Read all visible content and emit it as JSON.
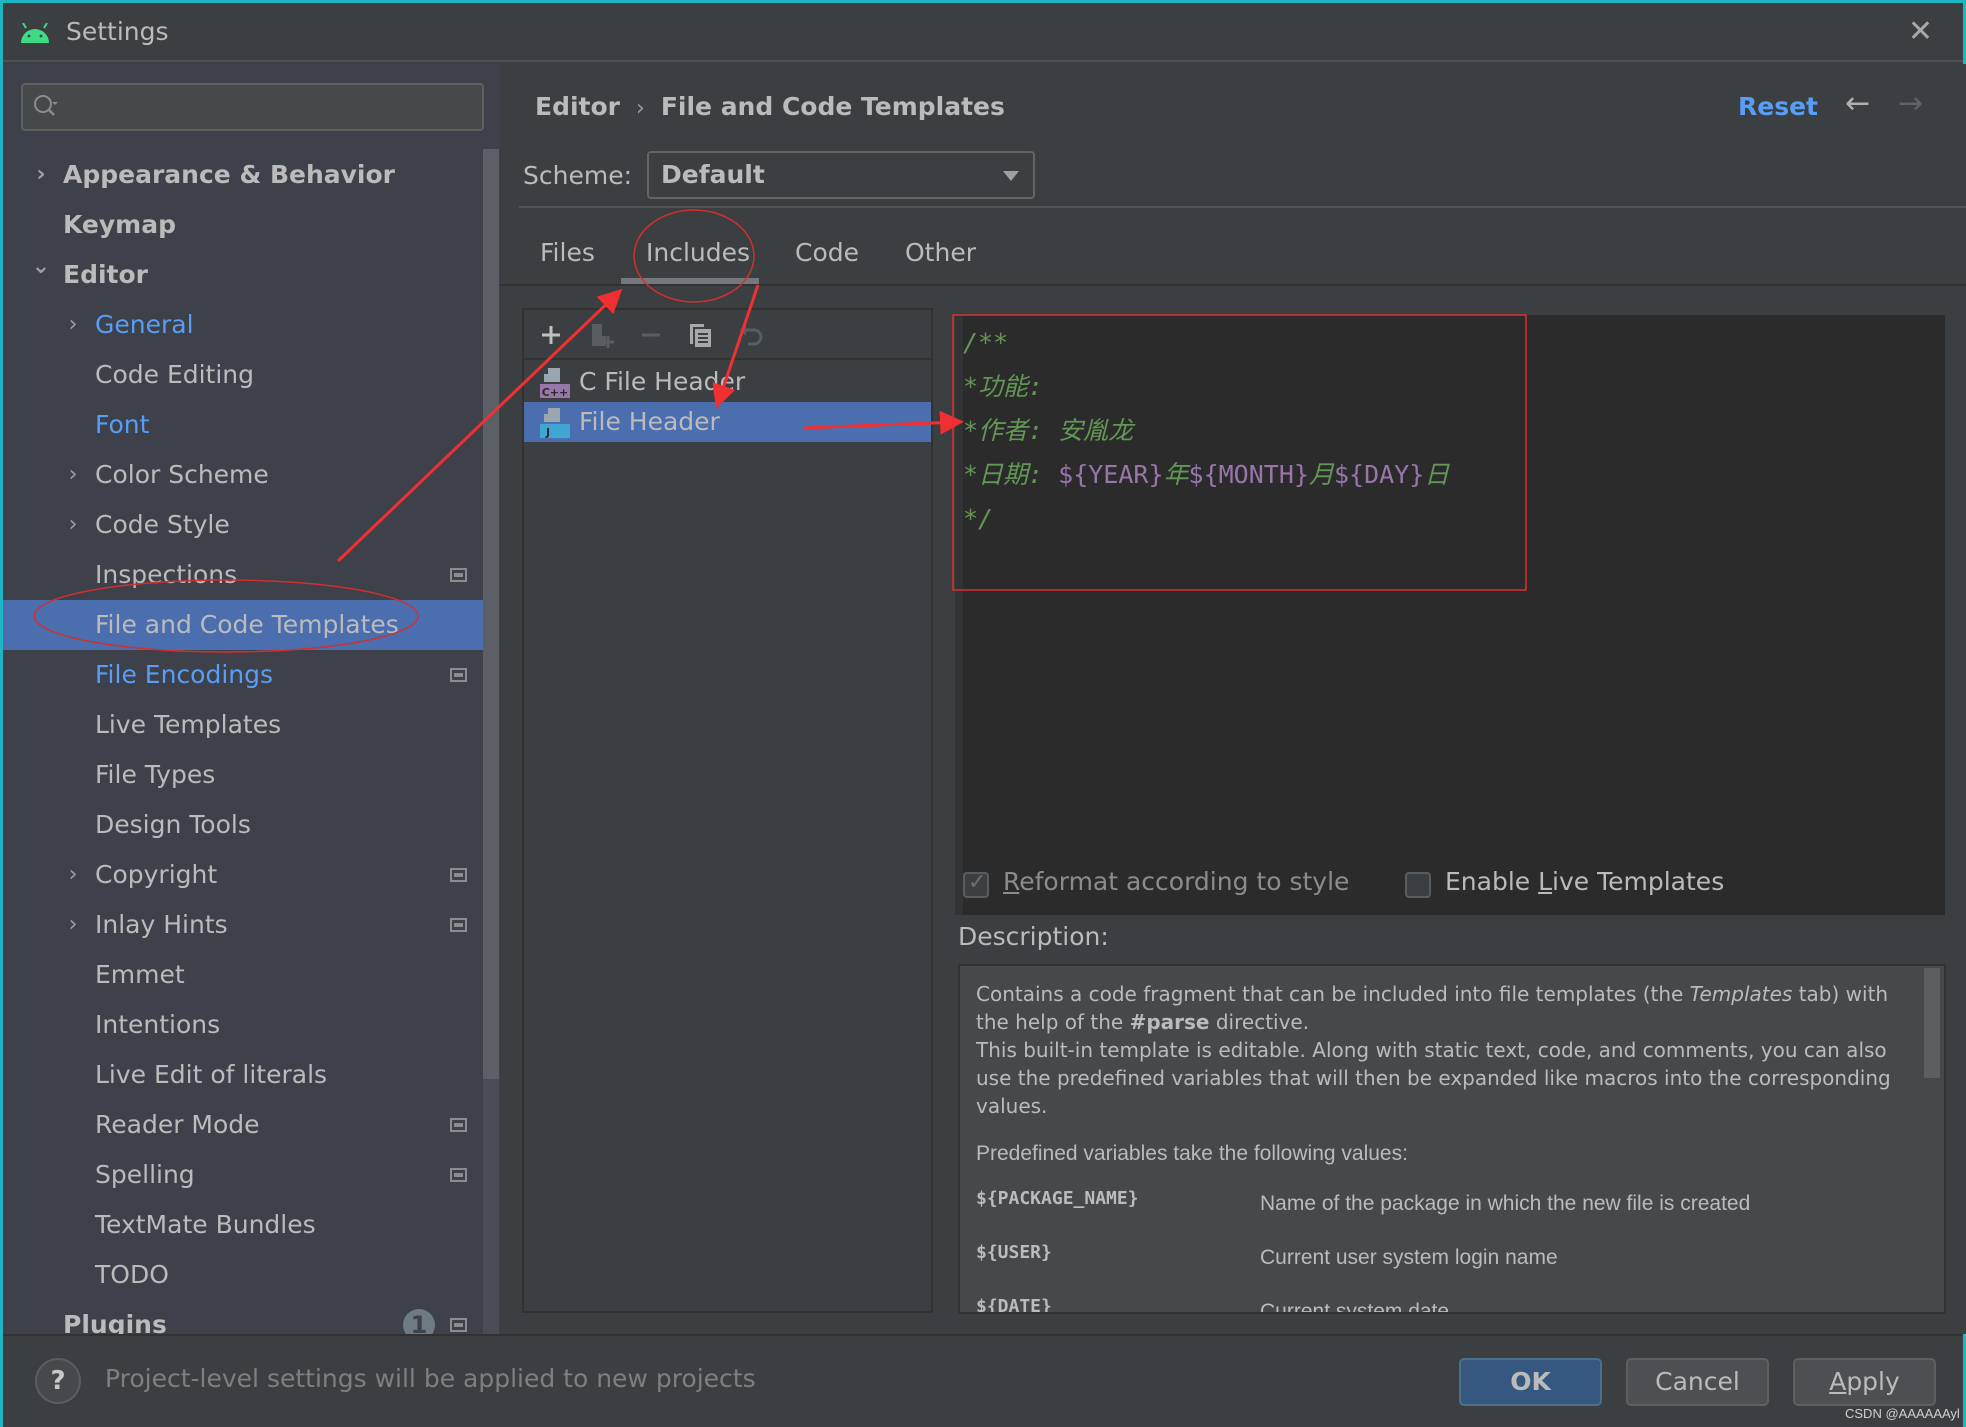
{
  "window": {
    "title": "Settings",
    "app_icon": "android-icon",
    "close_icon": "close-icon"
  },
  "sidebar": {
    "search": {
      "placeholder": "",
      "value": ""
    },
    "items": [
      {
        "label": "Appearance & Behavior",
        "level": 0,
        "bold": true,
        "expander": "collapsed"
      },
      {
        "label": "Keymap",
        "level": 0,
        "bold": true,
        "expander": "none"
      },
      {
        "label": "Editor",
        "level": 0,
        "bold": true,
        "expander": "expanded"
      },
      {
        "label": "General",
        "level": 1,
        "modified": true,
        "expander": "collapsed"
      },
      {
        "label": "Code Editing",
        "level": 1,
        "expander": "none"
      },
      {
        "label": "Font",
        "level": 1,
        "modified": true,
        "expander": "none"
      },
      {
        "label": "Color Scheme",
        "level": 1,
        "expander": "collapsed"
      },
      {
        "label": "Code Style",
        "level": 1,
        "expander": "collapsed"
      },
      {
        "label": "Inspections",
        "level": 1,
        "expander": "none",
        "project_level": true
      },
      {
        "label": "File and Code Templates",
        "level": 1,
        "expander": "none",
        "selected": true
      },
      {
        "label": "File Encodings",
        "level": 1,
        "modified": true,
        "expander": "none",
        "project_level": true
      },
      {
        "label": "Live Templates",
        "level": 1,
        "expander": "none"
      },
      {
        "label": "File Types",
        "level": 1,
        "expander": "none"
      },
      {
        "label": "Design Tools",
        "level": 1,
        "expander": "none"
      },
      {
        "label": "Copyright",
        "level": 1,
        "expander": "collapsed",
        "project_level": true
      },
      {
        "label": "Inlay Hints",
        "level": 1,
        "expander": "collapsed",
        "project_level": true
      },
      {
        "label": "Emmet",
        "level": 1,
        "expander": "none"
      },
      {
        "label": "Intentions",
        "level": 1,
        "expander": "none"
      },
      {
        "label": "Live Edit of literals",
        "level": 1,
        "expander": "none"
      },
      {
        "label": "Reader Mode",
        "level": 1,
        "expander": "none",
        "project_level": true
      },
      {
        "label": "Spelling",
        "level": 1,
        "expander": "none",
        "project_level": true
      },
      {
        "label": "TextMate Bundles",
        "level": 1,
        "expander": "none"
      },
      {
        "label": "TODO",
        "level": 1,
        "expander": "none"
      },
      {
        "label": "Plugins",
        "level": 0,
        "bold": true,
        "expander": "none",
        "badge": "1",
        "project_level": true
      }
    ]
  },
  "header": {
    "breadcrumb": [
      "Editor",
      "File and Code Templates"
    ],
    "breadcrumb_sep": "›",
    "reset_label": "Reset",
    "back_icon": "←",
    "forward_icon": "→"
  },
  "scheme": {
    "label": "Scheme:",
    "value": "Default"
  },
  "tabs": [
    {
      "label": "Files",
      "active": false
    },
    {
      "label": "Includes",
      "active": true
    },
    {
      "label": "Code",
      "active": false
    },
    {
      "label": "Other",
      "active": false
    }
  ],
  "template_list": {
    "toolbar": [
      {
        "name": "add-icon",
        "glyph": "+",
        "enabled": true
      },
      {
        "name": "add-child-icon",
        "glyph": "",
        "enabled": false
      },
      {
        "name": "remove-icon",
        "glyph": "−",
        "enabled": false
      },
      {
        "name": "copy-icon",
        "glyph": "",
        "enabled": true
      },
      {
        "name": "reset-icon",
        "glyph": "↺",
        "enabled": false
      }
    ],
    "items": [
      {
        "label": "C File Header",
        "icon": "cpp-file-icon",
        "icon_text": "C++",
        "selected": false
      },
      {
        "label": "File Header",
        "icon": "java-file-icon",
        "icon_text": "J",
        "selected": true
      }
    ]
  },
  "editor": {
    "lines": [
      [
        {
          "t": "/**",
          "k": "com"
        }
      ],
      [
        {
          "t": "*功能:",
          "k": "com"
        }
      ],
      [
        {
          "t": "*作者: 安胤龙",
          "k": "com"
        }
      ],
      [
        {
          "t": "*日期: ",
          "k": "com"
        },
        {
          "t": "${YEAR}",
          "k": "var"
        },
        {
          "t": "年",
          "k": "com"
        },
        {
          "t": "${MONTH}",
          "k": "var"
        },
        {
          "t": "月",
          "k": "com"
        },
        {
          "t": "${DAY}",
          "k": "var"
        },
        {
          "t": "日",
          "k": "com"
        }
      ],
      [
        {
          "t": "*/",
          "k": "com"
        }
      ]
    ],
    "colors": {
      "comment": "#629755",
      "variable": "#9876aa",
      "background": "#2b2b2b"
    }
  },
  "options": {
    "reformat": {
      "label_prefix": "",
      "mnemonic": "R",
      "label_rest": "eformat according to style",
      "checked": true,
      "enabled": false
    },
    "live_templates": {
      "label_prefix": "Enable ",
      "mnemonic": "L",
      "label_rest": "ive Templates",
      "checked": false,
      "enabled": true
    }
  },
  "description": {
    "label": "Description:",
    "p1_a": "Contains a code fragment that can be included into file templates (the ",
    "p1_em": "Templates",
    "p1_b": " tab) with the help of the ",
    "p1_strong": "#parse",
    "p1_c": " directive.",
    "p1_d": "This built-in template is editable. Along with static text, code, and comments, you can also use the predefined variables that will then be expanded like macros into the corresponding values.",
    "p2": "Predefined variables take the following values:",
    "variables": [
      {
        "name": "${PACKAGE_NAME}",
        "desc": "Name of the package in which the new file is created"
      },
      {
        "name": "${USER}",
        "desc": "Current user system login name"
      },
      {
        "name": "${DATE}",
        "desc": "Current system date"
      }
    ]
  },
  "footer": {
    "help_label": "?",
    "message": "Project-level settings will be applied to new projects",
    "ok_label": "OK",
    "cancel_label": "Cancel",
    "apply_mnemonic": "A",
    "apply_rest": "pply",
    "watermark": "CSDN @AAAAAAyl"
  },
  "colors": {
    "accent_blue": "#589df6",
    "selection": "#4b6eaf",
    "annotation_red": "#f03030"
  }
}
